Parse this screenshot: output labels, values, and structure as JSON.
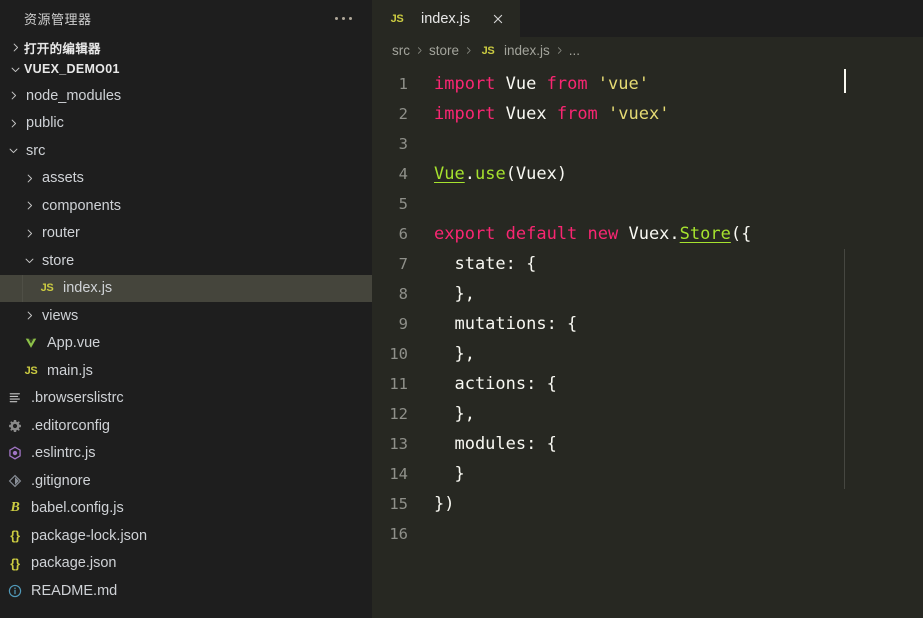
{
  "sidebar": {
    "title": "资源管理器",
    "more_actions": "more-actions",
    "sections": [
      {
        "label": "打开的编辑器",
        "expanded": false
      },
      {
        "label": "VUEX_DEMO01",
        "expanded": true
      }
    ],
    "tree": [
      {
        "name": "node_modules",
        "type": "folder",
        "expanded": false,
        "depth": 1,
        "icon": "chevron-right-icon",
        "selected": false
      },
      {
        "name": "public",
        "type": "folder",
        "expanded": false,
        "depth": 1,
        "icon": "chevron-right-icon",
        "selected": false
      },
      {
        "name": "src",
        "type": "folder",
        "expanded": true,
        "depth": 1,
        "icon": "chevron-down-icon",
        "selected": false
      },
      {
        "name": "assets",
        "type": "folder",
        "expanded": false,
        "depth": 2,
        "icon": "chevron-right-icon",
        "selected": false
      },
      {
        "name": "components",
        "type": "folder",
        "expanded": false,
        "depth": 2,
        "icon": "chevron-right-icon",
        "selected": false
      },
      {
        "name": "router",
        "type": "folder",
        "expanded": false,
        "depth": 2,
        "icon": "chevron-right-icon",
        "selected": false
      },
      {
        "name": "store",
        "type": "folder",
        "expanded": true,
        "depth": 2,
        "icon": "chevron-down-icon",
        "selected": false
      },
      {
        "name": "index.js",
        "type": "file",
        "depth": 3,
        "icon": "js-file-icon",
        "selected": true
      },
      {
        "name": "views",
        "type": "folder",
        "expanded": false,
        "depth": 2,
        "icon": "chevron-right-icon",
        "selected": false
      },
      {
        "name": "App.vue",
        "type": "file",
        "depth": 2,
        "icon": "vue-file-icon",
        "selected": false
      },
      {
        "name": "main.js",
        "type": "file",
        "depth": 2,
        "icon": "js-file-icon",
        "selected": false
      },
      {
        "name": ".browserslistrc",
        "type": "file",
        "depth": 1,
        "icon": "config-list-icon",
        "selected": false
      },
      {
        "name": ".editorconfig",
        "type": "file",
        "depth": 1,
        "icon": "gear-icon",
        "selected": false
      },
      {
        "name": ".eslintrc.js",
        "type": "file",
        "depth": 1,
        "icon": "eslint-icon",
        "selected": false
      },
      {
        "name": ".gitignore",
        "type": "file",
        "depth": 1,
        "icon": "git-icon",
        "selected": false
      },
      {
        "name": "babel.config.js",
        "type": "file",
        "depth": 1,
        "icon": "babel-icon",
        "selected": false
      },
      {
        "name": "package-lock.json",
        "type": "file",
        "depth": 1,
        "icon": "json-icon",
        "selected": false
      },
      {
        "name": "package.json",
        "type": "file",
        "depth": 1,
        "icon": "json-icon",
        "selected": false
      },
      {
        "name": "README.md",
        "type": "file",
        "depth": 1,
        "icon": "readme-info-icon",
        "selected": false
      }
    ]
  },
  "editor": {
    "tabs": [
      {
        "label": "index.js",
        "icon": "js-file-icon",
        "active": true,
        "close": "close-icon"
      }
    ],
    "breadcrumb": [
      {
        "label": "src",
        "icon": null
      },
      {
        "label": "store",
        "icon": null
      },
      {
        "label": "index.js",
        "icon": "js-file-icon"
      },
      {
        "label": "...",
        "icon": null
      }
    ],
    "line_numbers": [
      "1",
      "2",
      "3",
      "4",
      "5",
      "6",
      "7",
      "8",
      "9",
      "10",
      "11",
      "12",
      "13",
      "14",
      "15",
      "16"
    ],
    "code_lines": [
      [
        {
          "t": "import ",
          "c": "kw"
        },
        {
          "t": "Vue ",
          "c": "idn"
        },
        {
          "t": "from ",
          "c": "kw"
        },
        {
          "t": "'vue'",
          "c": "str"
        }
      ],
      [
        {
          "t": "import ",
          "c": "kw"
        },
        {
          "t": "Vuex ",
          "c": "idn"
        },
        {
          "t": "from ",
          "c": "kw"
        },
        {
          "t": "'vuex'",
          "c": "str"
        }
      ],
      [],
      [
        {
          "t": "Vue",
          "c": "fn und"
        },
        {
          "t": ".",
          "c": "pun"
        },
        {
          "t": "use",
          "c": "fn"
        },
        {
          "t": "(Vuex)",
          "c": "idn"
        }
      ],
      [],
      [
        {
          "t": "export default new ",
          "c": "kw"
        },
        {
          "t": "Vuex.",
          "c": "idn"
        },
        {
          "t": "Store",
          "c": "fn und"
        },
        {
          "t": "({",
          "c": "idn"
        }
      ],
      [
        {
          "t": "  state: {",
          "c": "idn"
        }
      ],
      [
        {
          "t": "  },",
          "c": "idn"
        }
      ],
      [
        {
          "t": "  mutations: {",
          "c": "idn"
        }
      ],
      [
        {
          "t": "  },",
          "c": "idn"
        }
      ],
      [
        {
          "t": "  actions: {",
          "c": "idn"
        }
      ],
      [
        {
          "t": "  },",
          "c": "idn"
        }
      ],
      [
        {
          "t": "  modules: {",
          "c": "idn"
        }
      ],
      [
        {
          "t": "  }",
          "c": "idn"
        }
      ],
      [
        {
          "t": "})",
          "c": "idn"
        }
      ],
      []
    ]
  },
  "colors": {
    "sidebar_bg": "#1e1e1e",
    "editor_bg": "#272822",
    "selection_bg": "#45453c",
    "keyword": "#f92672",
    "string": "#e6db74",
    "function": "#a6e22e",
    "identifier": "#f8f8f2",
    "line_number": "#8f908a"
  }
}
